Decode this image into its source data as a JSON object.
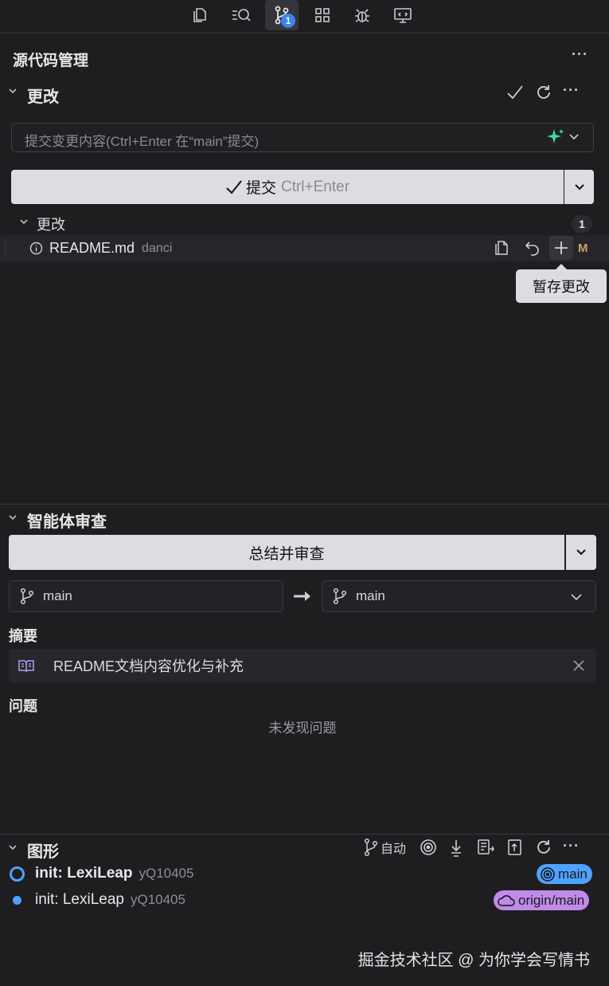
{
  "activity_bar": {
    "icons": [
      "explorer-icon",
      "search-icon",
      "source-control-icon",
      "extensions-icon",
      "debug-icon",
      "remote-icon"
    ],
    "badge": "1"
  },
  "panel": {
    "title": "源代码管理"
  },
  "changes": {
    "title": "更改",
    "commit_placeholder": "提交变更内容(Ctrl+Enter 在“main”提交)",
    "commit_button": "提交",
    "commit_shortcut": "Ctrl+Enter",
    "group_label": "更改",
    "group_count": "1",
    "file": {
      "name": "README.md",
      "dir": "danci",
      "status": "M"
    },
    "tooltip": "暂存更改"
  },
  "agent_review": {
    "title": "智能体审查",
    "button": "总结并审查",
    "source_branch": "main",
    "target_branch": "main",
    "summary_label": "摘要",
    "summary_text": "README文档内容优化与补充",
    "issues_label": "问题",
    "issues_empty": "未发现问题"
  },
  "graph": {
    "title": "图形",
    "auto_label": "自动",
    "commits": [
      {
        "message": "init: LexiLeap",
        "author": "yQ10405",
        "ref": "main",
        "ref_color": "#4da3ff"
      },
      {
        "message": "init: LexiLeap",
        "author": "yQ10405",
        "ref": "origin/main",
        "ref_color": "#c08be8"
      }
    ]
  },
  "watermark": "掘金技术社区 @ 为你学会写情书"
}
